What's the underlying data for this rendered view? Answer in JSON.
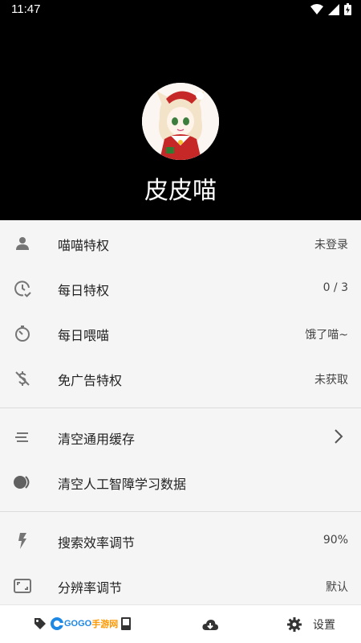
{
  "status_bar": {
    "time": "11:47"
  },
  "profile": {
    "username": "皮皮喵"
  },
  "section_privileges": [
    {
      "icon": "person-icon",
      "label": "喵喵特权",
      "value": "未登录"
    },
    {
      "icon": "clock-check-icon",
      "label": "每日特权",
      "value": "0 / 3"
    },
    {
      "icon": "timer-icon",
      "label": "每日喂喵",
      "value": "饿了喵~"
    },
    {
      "icon": "no-ads-icon",
      "label": "免广告特权",
      "value": "未获取"
    }
  ],
  "section_cache": [
    {
      "icon": "clear-lines-icon",
      "label": "清空通用缓存"
    },
    {
      "icon": "toggle-icon",
      "label": "清空人工智障学习数据"
    }
  ],
  "section_tuning": [
    {
      "icon": "flash-icon",
      "label": "搜索效率调节",
      "value": "90%"
    },
    {
      "icon": "resolution-icon",
      "label": "分辨率调节",
      "value": "默认"
    }
  ],
  "bottom_nav": {
    "logo_text_1": "GOGO",
    "logo_text_2": "手游网",
    "settings_label": "设置"
  },
  "colors": {
    "header_bg": "#000000",
    "list_bg": "#f5f5f5",
    "icon_gray": "#757575"
  }
}
